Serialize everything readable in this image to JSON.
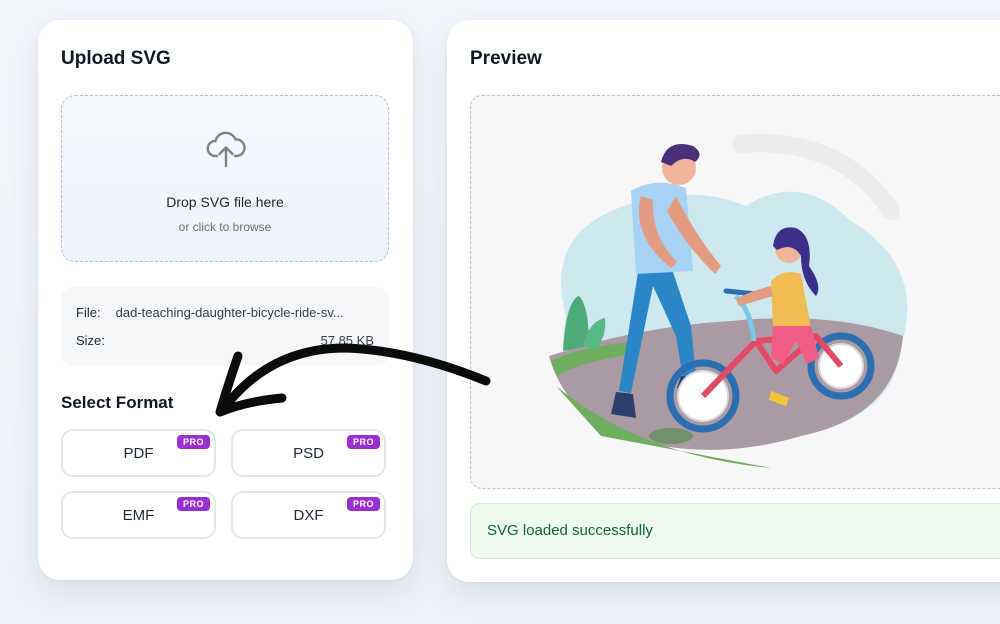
{
  "upload": {
    "title": "Upload SVG",
    "drop_title": "Drop SVG file here",
    "drop_sub": "or click to browse",
    "file_label": "File:",
    "file_name": "dad-teaching-daughter-bicycle-ride-sv...",
    "size_label": "Size:",
    "size_value": "57.85 KB",
    "upload_icon": "cloud-upload-icon"
  },
  "formats": {
    "title": "Select Format",
    "items": [
      {
        "label": "PDF",
        "badge": "PRO"
      },
      {
        "label": "PSD",
        "badge": "PRO"
      },
      {
        "label": "EMF",
        "badge": "PRO"
      },
      {
        "label": "DXF",
        "badge": "PRO"
      }
    ],
    "badge_color": "#9b2fd1"
  },
  "preview": {
    "title": "Preview",
    "status": "SVG loaded successfully",
    "status_color": "#166534"
  }
}
